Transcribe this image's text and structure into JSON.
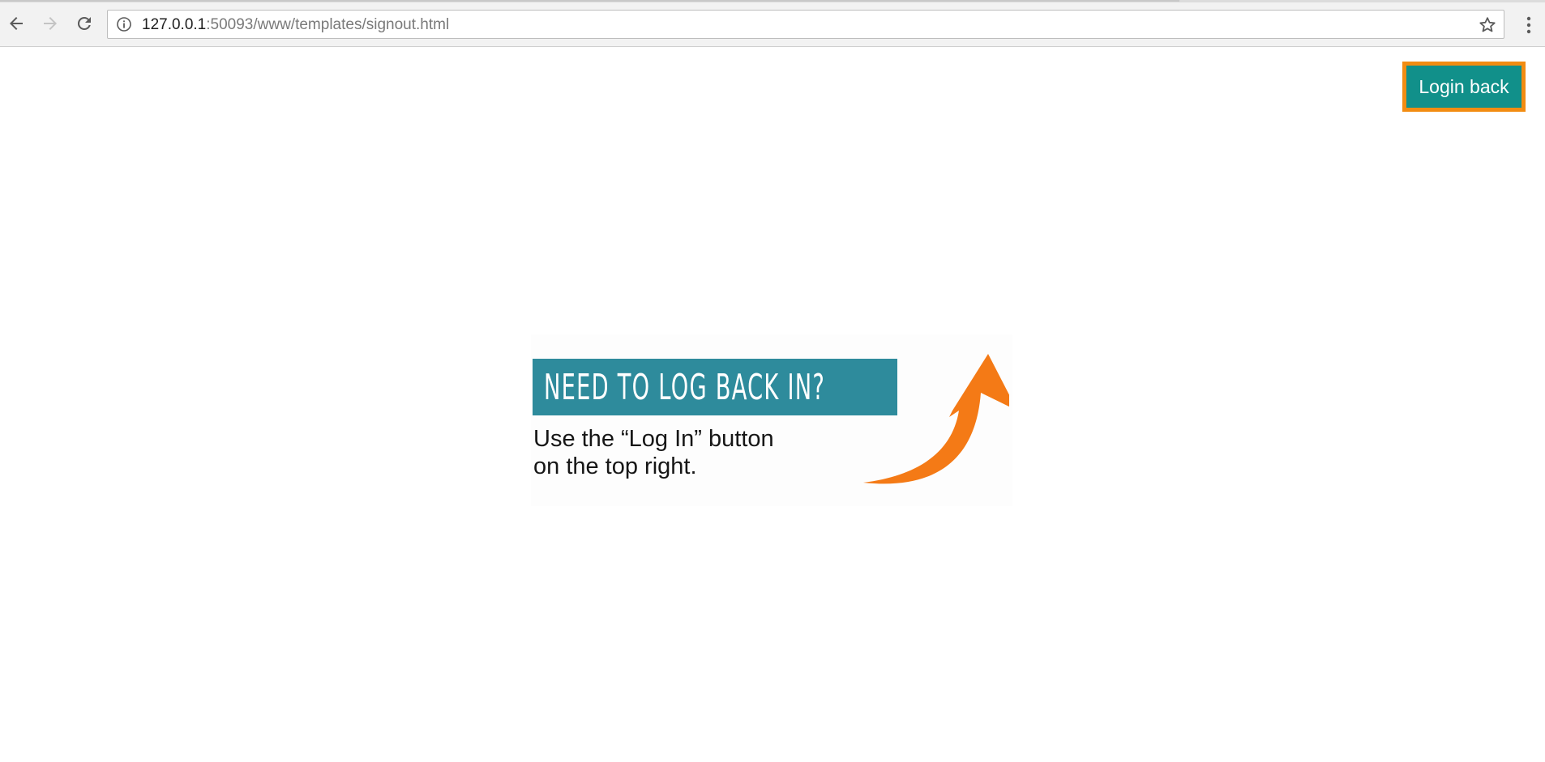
{
  "browser": {
    "url_host": "127.0.0.1",
    "url_path": ":50093/www/templates/signout.html",
    "icons": [
      "back-icon",
      "forward-icon",
      "reload-icon",
      "info-icon",
      "star-icon",
      "menu-icon"
    ]
  },
  "page": {
    "login_button_label": "Login back",
    "promo": {
      "heading": "NEED TO LOG BACK IN?",
      "line1": "Use the “Log In” button",
      "line2": "on the top right."
    }
  },
  "colors": {
    "button_bg": "#11908a",
    "button_border": "#f28c12",
    "banner_bg": "#2e8b9c",
    "arrow": "#f47a16"
  }
}
